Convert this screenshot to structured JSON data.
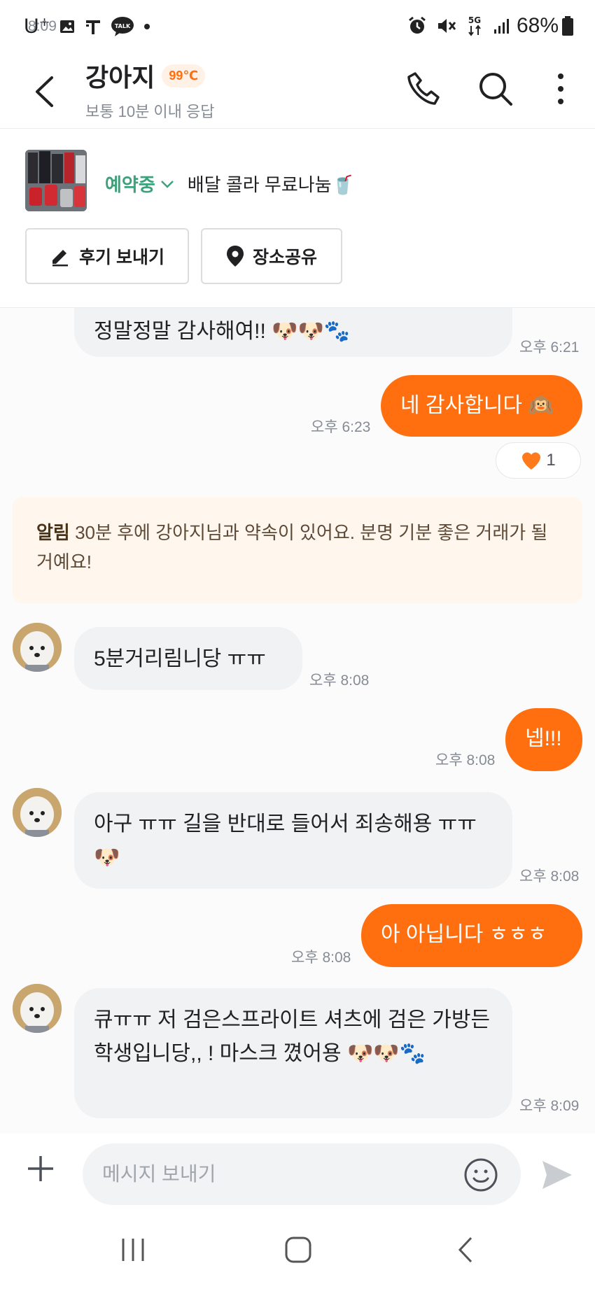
{
  "status_bar": {
    "carrier": "U⁺",
    "time": "8:09",
    "battery": "68%",
    "network": "5G"
  },
  "header": {
    "title": "강아지",
    "temperature": "99℃",
    "subtitle": "보통 10분 이내 응답",
    "icons": [
      "back-arrow-icon",
      "phone-icon",
      "search-icon",
      "more-vertical-icon"
    ]
  },
  "product": {
    "status": "예약중",
    "title": "배달 콜라 무료나눔🥤",
    "buttons": {
      "review": "후기 보내기",
      "location": "장소공유"
    }
  },
  "messages": [
    {
      "dir": "in",
      "text": "정말정말 감사해여!! 🐶🐶🐾",
      "time": "오후 6:21"
    },
    {
      "dir": "out",
      "text": "네 감사합니다 🙉",
      "time": "오후 6:23",
      "reaction": {
        "emoji": "🧡",
        "count": "1"
      }
    },
    {
      "dir": "in",
      "text": "5분거리림니당 ㅠㅠ",
      "time": "오후 8:08"
    },
    {
      "dir": "out",
      "text": "넵!!!",
      "time": "오후 8:08"
    },
    {
      "dir": "in",
      "text": "아구 ㅠㅠ 길을 반대로 들어서 죄송해용 ㅠㅠ 🐶",
      "time": "오후 8:08"
    },
    {
      "dir": "out",
      "text": "아 아닙니다 ㅎㅎㅎ",
      "time": "오후 8:08"
    },
    {
      "dir": "in",
      "text": "큐ㅠㅠ 저 검은스프라이트 셔츠에 검은 가방든 학생입니당,, ! 마스크 꼈어용 🐶🐶🐾",
      "time": "오후 8:09"
    }
  ],
  "notice": {
    "label": "알림",
    "text": "30분 후에 강아지님과 약속이 있어요. 분명 기분 좋은 거래가 될 거예요!"
  },
  "composer": {
    "placeholder": "메시지 보내기"
  },
  "colors": {
    "accent": "#ff6f0f",
    "status_green": "#3da17c",
    "incoming_bubble": "#f1f2f4",
    "notice_bg": "#fff6ee"
  }
}
